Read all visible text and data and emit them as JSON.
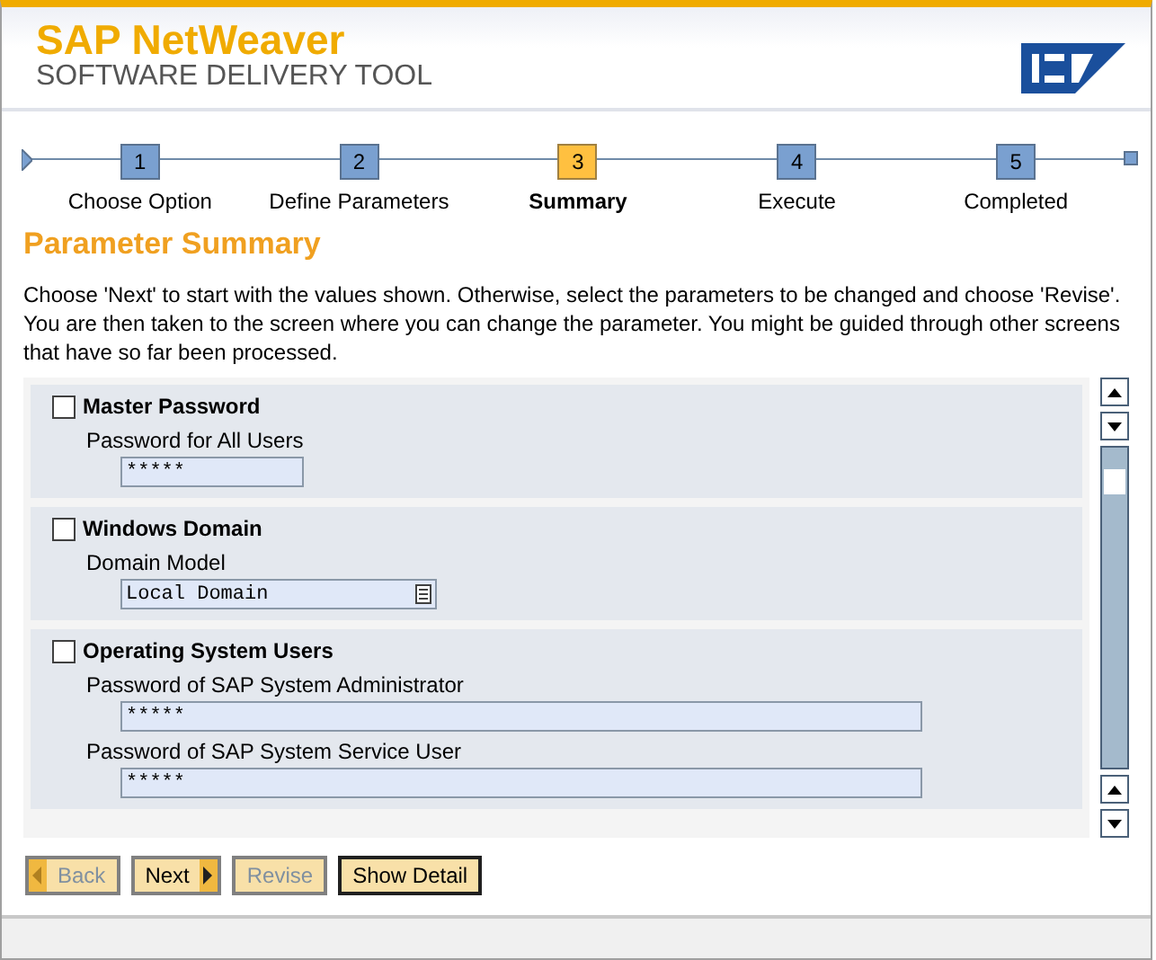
{
  "header": {
    "product": "SAP NetWeaver",
    "subtitle": "SOFTWARE DELIVERY TOOL"
  },
  "steps": [
    {
      "number": "1",
      "label": "Choose Option",
      "selected": false
    },
    {
      "number": "2",
      "label": "Define Parameters",
      "selected": false
    },
    {
      "number": "3",
      "label": "Summary",
      "selected": true
    },
    {
      "number": "4",
      "label": "Execute",
      "selected": false
    },
    {
      "number": "5",
      "label": "Completed",
      "selected": false
    }
  ],
  "page_title": "Parameter Summary",
  "intro": "Choose 'Next' to start with the values shown. Otherwise, select the parameters to be changed and choose 'Revise'. You are then taken to the screen where you can change the parameter. You might be guided through other screens that have so far been processed.",
  "groups": [
    {
      "title": "Master Password",
      "checked": false,
      "fields": [
        {
          "label": "Password for All Users",
          "value": "*****",
          "kind": "password"
        }
      ]
    },
    {
      "title": "Windows Domain",
      "checked": false,
      "fields": [
        {
          "label": "Domain Model",
          "value": "Local Domain",
          "kind": "dropdown"
        }
      ]
    },
    {
      "title": "Operating System Users",
      "checked": false,
      "fields": [
        {
          "label": "Password of SAP System Administrator",
          "value": "*****",
          "kind": "password"
        },
        {
          "label": "Password of SAP System Service User",
          "value": "*****",
          "kind": "password"
        }
      ]
    }
  ],
  "buttons": [
    {
      "label": "Back",
      "kind": "back",
      "disabled": true,
      "default": false
    },
    {
      "label": "Next",
      "kind": "next",
      "disabled": false,
      "default": false
    },
    {
      "label": "Revise",
      "kind": "plain",
      "disabled": true,
      "default": false
    },
    {
      "label": "Show Detail",
      "kind": "plain",
      "disabled": false,
      "default": true
    }
  ]
}
